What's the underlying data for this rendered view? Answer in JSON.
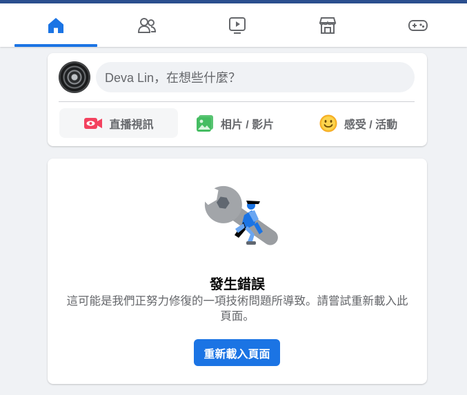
{
  "colors": {
    "accent": "#1b74e4",
    "top_strip": "#2b4f8f",
    "icon_gray": "#65676b",
    "background": "#f0f2f5",
    "live_red": "#f3425f",
    "photo_green": "#45bd62",
    "feeling_yellow": "#f7b928"
  },
  "nav": {
    "tabs": [
      {
        "icon": "home-icon",
        "active": true
      },
      {
        "icon": "friends-icon",
        "active": false
      },
      {
        "icon": "watch-icon",
        "active": false
      },
      {
        "icon": "marketplace-icon",
        "active": false
      },
      {
        "icon": "gaming-icon",
        "active": false
      }
    ]
  },
  "composer": {
    "avatar_icon": "camera-lens-avatar",
    "prompt": "Deva Lin，在想些什麼？",
    "actions": [
      {
        "icon": "live-video-icon",
        "label": "直播視訊"
      },
      {
        "icon": "photo-video-icon",
        "label": "相片 / 影片"
      },
      {
        "icon": "feeling-activity-icon",
        "label": "感受 / 活動"
      }
    ]
  },
  "error": {
    "illustration": "wrench-worker-illustration",
    "title": "發生錯誤",
    "message": "這可能是我們正努力修復的一項技術問題所導致。請嘗試重新載入此頁面。",
    "reload_label": "重新載入頁面"
  }
}
